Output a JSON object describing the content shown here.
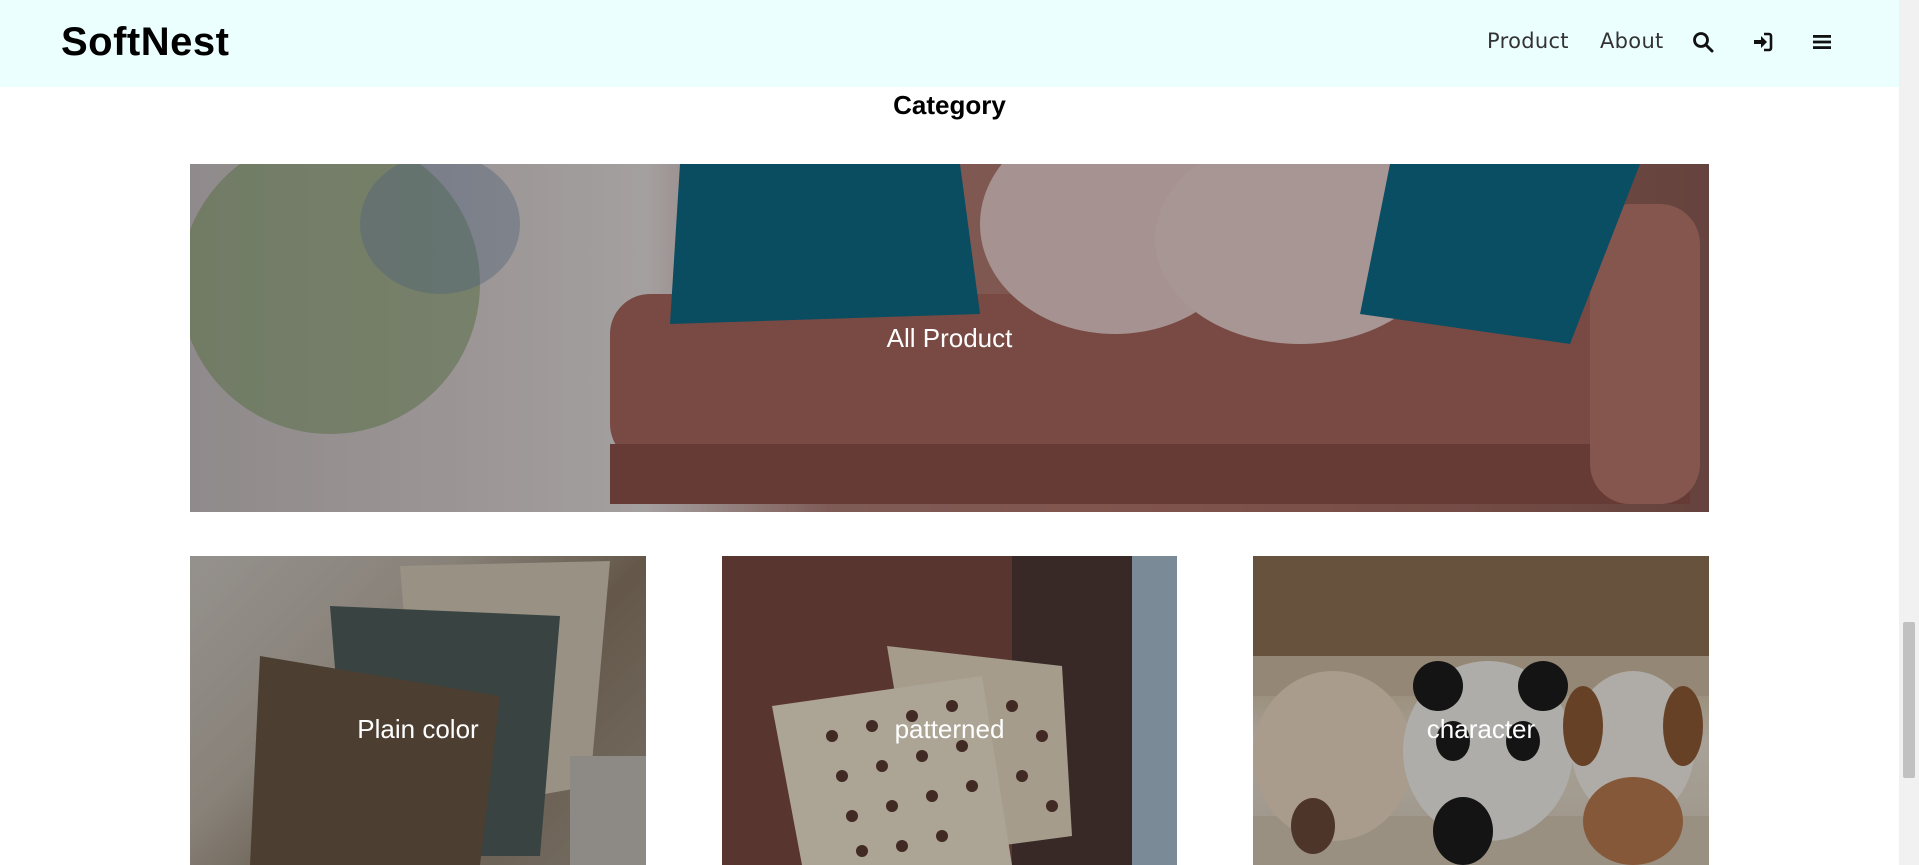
{
  "header": {
    "brand": "SoftNest",
    "nav": {
      "product": "Product",
      "about": "About"
    },
    "icons": {
      "search": "search-icon",
      "login": "sign-in-icon",
      "menu": "hamburger-menu-icon"
    },
    "background": "#ecffff"
  },
  "section": {
    "title": "Category"
  },
  "categories": {
    "all": {
      "label": "All Product"
    },
    "plain": {
      "label": "Plain color"
    },
    "patterned": {
      "label": "patterned"
    },
    "character": {
      "label": "character"
    }
  }
}
